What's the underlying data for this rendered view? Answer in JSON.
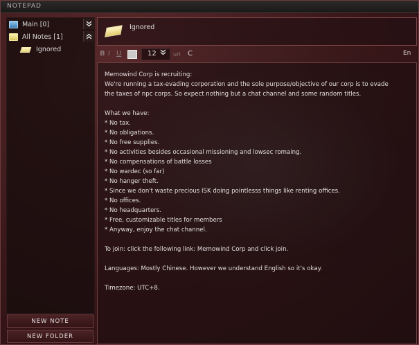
{
  "window": {
    "title": "NOTEPAD"
  },
  "tree": {
    "main_folder": "Main [0]",
    "all_notes_folder": "All Notes [1]",
    "note_item": "Ignored",
    "expand_icon": "double-chevron-down",
    "collapse_icon": "double-chevron-up"
  },
  "buttons": {
    "new_note": "NEW NOTE",
    "new_folder": "NEW FOLDER"
  },
  "note": {
    "title": "Ignored"
  },
  "toolbar": {
    "bold": "B",
    "italic": "I",
    "underline": "U",
    "font_size": "12",
    "url": "url",
    "clear": "C",
    "language": "En"
  },
  "body_lines": [
    "Memowind Corp is recruiting:",
    "We're running a tax-evading corporation and the sole purpose/objective of our corp is to evade",
    "the taxes of npc corps. So expect nothing but a chat channel and some random titles.",
    "",
    "What we have:",
    "* No tax.",
    "* No obligations.",
    "* No free supplies.",
    "* No activities besides occasional missioning and lowsec romaing.",
    "* No compensations of battle losses",
    "* No wardec (so far)",
    "* No hanger theft.",
    "* Since we don't waste precious ISK doing pointlesss things like renting offices.",
    "* No offices.",
    "* No headquarters.",
    "* Free, customizable titles for members",
    "* Anyway, enjoy the chat channel.",
    "",
    "To join: click the following link: Memowind Corp and click join.",
    "",
    "Languages: Mostly Chinese. However we understand English so it's okay.",
    "",
    "Timezone: UTC+8."
  ]
}
